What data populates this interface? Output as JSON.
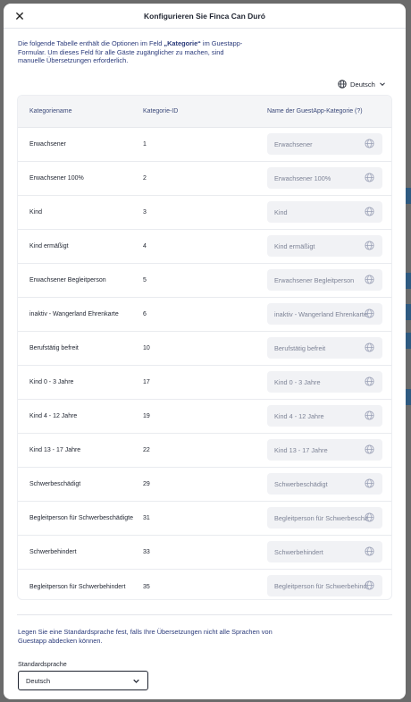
{
  "modal": {
    "title": "Konfigurieren Sie Finca Can Duró",
    "close_icon": "close-icon"
  },
  "intro": {
    "part1": "Die folgende Tabelle enthält die Optionen im Feld ",
    "field_name": "„Kategorie“",
    "part2": " im Guestapp-Formular. Um dieses Feld für alle Gäste zugänglicher zu machen, sind manuelle Übersetzungen erforderlich."
  },
  "language_selector": {
    "icon": "globe-icon",
    "value": "Deutsch",
    "chevron": "chevron-down-icon"
  },
  "table": {
    "headers": {
      "name": "Kategoriename",
      "id": "Kategorie-ID",
      "guestapp": "Name der GuestApp-Kategorie (?)"
    },
    "rows": [
      {
        "name": "Erwachsener",
        "id": "1",
        "placeholder": "Erwachsener"
      },
      {
        "name": "Erwachsener 100%",
        "id": "2",
        "placeholder": "Erwachsener 100%"
      },
      {
        "name": "Kind",
        "id": "3",
        "placeholder": "Kind"
      },
      {
        "name": "Kind ermäßigt",
        "id": "4",
        "placeholder": "Kind ermäßigt"
      },
      {
        "name": "Erwachsener Begleitperson",
        "id": "5",
        "placeholder": "Erwachsener Begleitperson"
      },
      {
        "name": "inaktiv - Wangerland Ehrenkarte",
        "id": "6",
        "placeholder": "inaktiv - Wangerland Ehrenkarte"
      },
      {
        "name": "Berufstätig befreit",
        "id": "10",
        "placeholder": "Berufstätig befreit"
      },
      {
        "name": "Kind 0 - 3 Jahre",
        "id": "17",
        "placeholder": "Kind 0 - 3 Jahre"
      },
      {
        "name": "Kind 4 - 12 Jahre",
        "id": "19",
        "placeholder": "Kind 4 - 12 Jahre"
      },
      {
        "name": "Kind 13 - 17 Jahre",
        "id": "22",
        "placeholder": "Kind 13 - 17 Jahre"
      },
      {
        "name": "Schwerbeschädigt",
        "id": "29",
        "placeholder": "Schwerbeschädigt"
      },
      {
        "name": "Begleitperson für Schwerbeschädigte",
        "id": "31",
        "placeholder": "Begleitperson für Schwerbeschädigte"
      },
      {
        "name": "Schwerbehindert",
        "id": "33",
        "placeholder": "Schwerbehindert"
      },
      {
        "name": "Begleitperson für Schwerbehindert",
        "id": "35",
        "placeholder": "Begleitperson für Schwerbehindert"
      }
    ]
  },
  "footer": {
    "text": "Legen Sie eine Standardsprache fest, falls Ihre Übersetzungen nicht alle Sprachen von Guestapp abdecken können.",
    "label": "Standardsprache",
    "select_value": "Deutsch"
  }
}
